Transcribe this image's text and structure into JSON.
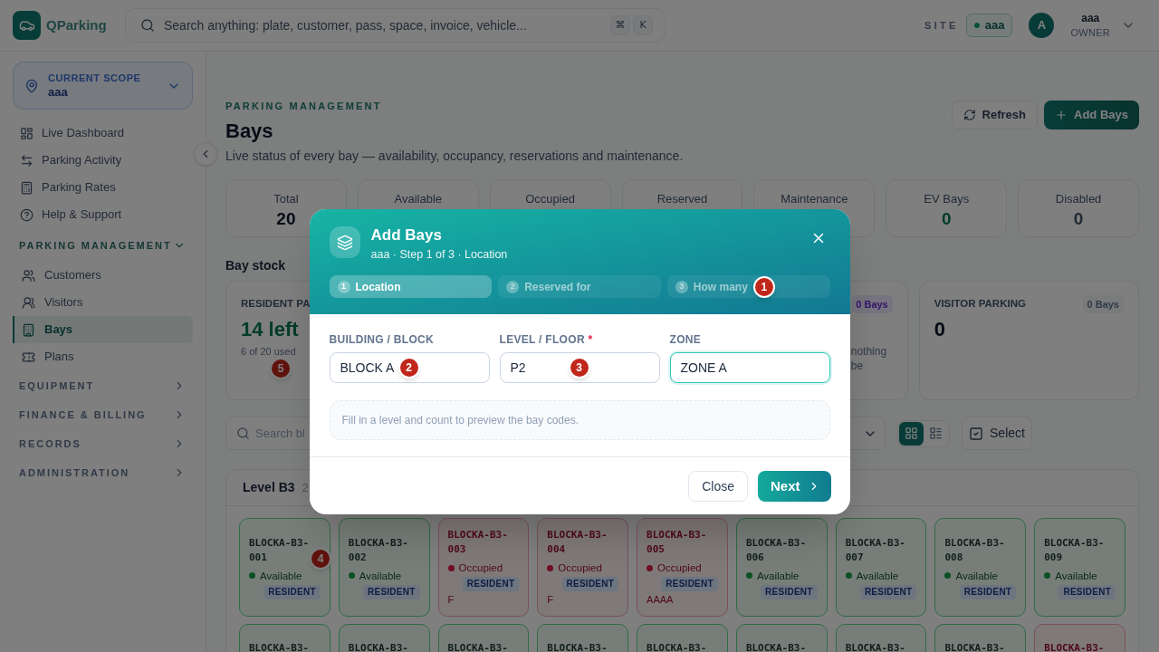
{
  "app": {
    "brand": "QParking",
    "search_placeholder": "Search anything: plate, customer, pass, space, invoice, vehicle...",
    "shortcut_keys": [
      "⌘",
      "K"
    ],
    "site_label": "SITE",
    "site": "aaa",
    "user": {
      "initial": "A",
      "name": "aaa",
      "role": "OWNER"
    }
  },
  "sidebar": {
    "scope": {
      "label": "CURRENT SCOPE",
      "value": "aaa"
    },
    "items": [
      {
        "label": "Live Dashboard",
        "selected": false
      },
      {
        "label": "Parking Activity",
        "selected": false
      },
      {
        "label": "Parking Rates",
        "selected": false
      },
      {
        "label": "Help & Support",
        "selected": false
      }
    ],
    "sections": [
      {
        "title": "PARKING MANAGEMENT",
        "expanded": true,
        "items": [
          {
            "label": "Customers",
            "selected": false
          },
          {
            "label": "Visitors",
            "selected": false
          },
          {
            "label": "Bays",
            "selected": true
          },
          {
            "label": "Plans",
            "selected": false
          }
        ]
      },
      {
        "title": "EQUIPMENT",
        "expanded": false
      },
      {
        "title": "FINANCE & BILLING",
        "expanded": false
      },
      {
        "title": "RECORDS",
        "expanded": false
      },
      {
        "title": "ADMINISTRATION",
        "expanded": false
      }
    ]
  },
  "page": {
    "eyebrow": "PARKING MANAGEMENT",
    "title": "Bays",
    "subtitle": "Live status of every bay — availability, occupancy, reservations and maintenance.",
    "actions": [
      {
        "label": "Refresh",
        "kind": "secondary"
      },
      {
        "label": "Add Bays",
        "kind": "primary"
      }
    ]
  },
  "stats": [
    {
      "label": "Total",
      "value": "20",
      "kind": "strong"
    },
    {
      "label": "Available"
    },
    {
      "label": "Occupied"
    },
    {
      "label": "Reserved"
    },
    {
      "label": "Maintenance"
    },
    {
      "label": "EV Bays",
      "value": "0",
      "kind": "positive"
    },
    {
      "label": "Disabled",
      "value": "0",
      "kind": "muted"
    }
  ],
  "bay_stock": {
    "title": "Bay stock",
    "cards": [
      {
        "title": "RESIDENT PA",
        "value": {
          "text": "14 left",
          "kind": "positive"
        },
        "note": "6 of 20 used",
        "marker": "5"
      },
      {
        "badge": {
          "text": "0 Bays",
          "kind": "accent"
        },
        "note": "nothing be"
      },
      {
        "title": "VISITOR PARKING",
        "badge": {
          "text": "0 Bays",
          "kind": "neutral"
        },
        "value": {
          "text": "0",
          "kind": "strong"
        }
      }
    ]
  },
  "toolbar": {
    "search_placeholder": "Search bl",
    "views": [
      {
        "selected": true
      },
      {
        "selected": false
      }
    ],
    "select_label": "Select"
  },
  "level": {
    "title": "Level B3",
    "count": "2",
    "bays": [
      {
        "code": "BLOCKA-B3-001",
        "kind": "available",
        "status": "Available",
        "tag": "RESIDENT",
        "marker": "4"
      },
      {
        "code": "BLOCKA-B3-002",
        "kind": "available",
        "status": "Available",
        "tag": "RESIDENT"
      },
      {
        "code": "BLOCKA-B3-003",
        "kind": "occupied",
        "status": "Occupied",
        "tag": "RESIDENT",
        "note": "F"
      },
      {
        "code": "BLOCKA-B3-004",
        "kind": "occupied",
        "status": "Occupied",
        "tag": "RESIDENT",
        "note": "F"
      },
      {
        "code": "BLOCKA-B3-005",
        "kind": "occupied",
        "status": "Occupied",
        "tag": "RESIDENT",
        "note": "AAAA"
      },
      {
        "code": "BLOCKA-B3-006",
        "kind": "available",
        "status": "Available",
        "tag": "RESIDENT"
      },
      {
        "code": "BLOCKA-B3-007",
        "kind": "available",
        "status": "Available",
        "tag": "RESIDENT"
      },
      {
        "code": "BLOCKA-B3-008",
        "kind": "available",
        "status": "Available",
        "tag": "RESIDENT"
      },
      {
        "code": "BLOCKA-B3-009",
        "kind": "available",
        "status": "Available",
        "tag": "RESIDENT"
      },
      {
        "code": "BLOCKA-B3-",
        "kind": "available"
      },
      {
        "code": "BLOCKA-B3-",
        "kind": "available"
      },
      {
        "code": "BLOCKA-B3-",
        "kind": "available"
      },
      {
        "code": "BLOCKA-B3-",
        "kind": "available"
      },
      {
        "code": "BLOCKA-B3-",
        "kind": "available"
      },
      {
        "code": "BLOCKA-B3-",
        "kind": "available"
      },
      {
        "code": "BLOCKA-B3-",
        "kind": "available"
      },
      {
        "code": "BLOCKA-B3-",
        "kind": "available"
      },
      {
        "code": "BLOCKA-B3-",
        "kind": "occupied"
      }
    ]
  },
  "modal": {
    "title": "Add Bays",
    "subtitle": "aaa · Step 1 of 3 · Location",
    "steps": [
      {
        "number": "1",
        "label": "Location",
        "selected": true
      },
      {
        "number": "2",
        "label": "Reserved for",
        "selected": false
      },
      {
        "number": "3",
        "label": "How many",
        "selected": false,
        "marker": "1"
      }
    ],
    "fields": [
      {
        "label": "BUILDING / BLOCK",
        "value": "BLOCK A",
        "focused": false,
        "marker": "2"
      },
      {
        "label": "LEVEL / FLOOR",
        "required_mark": "*",
        "value": "P2",
        "focused": false,
        "marker": "3"
      },
      {
        "label": "ZONE",
        "value": "ZONE A",
        "focused": true
      }
    ],
    "hint": "Fill in a level and count to preview the bay codes.",
    "buttons": [
      {
        "label": "Close",
        "kind": "secondary"
      },
      {
        "label": "Next",
        "kind": "primary"
      }
    ]
  }
}
